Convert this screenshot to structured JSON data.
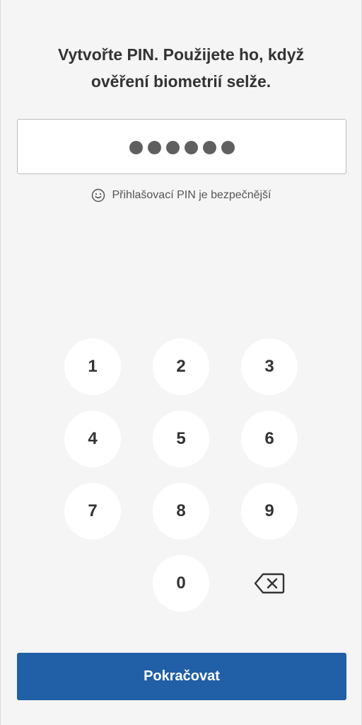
{
  "title": {
    "line1": "Vytvořte PIN. Použijete ho, když",
    "line2": "ověření biometrií selže."
  },
  "pin": {
    "entered_digits": 6,
    "masked": "●●●●●●"
  },
  "hint": {
    "icon": "smiley-icon",
    "text": "Přihlašovací PIN je bezpečnější"
  },
  "keypad": {
    "keys": [
      "1",
      "2",
      "3",
      "4",
      "5",
      "6",
      "7",
      "8",
      "9",
      "0"
    ],
    "backspace_icon": "backspace-icon"
  },
  "continue_label": "Pokračovat",
  "colors": {
    "primary": "#215fa7",
    "background": "#f5f5f5",
    "dot": "#5f5f5f"
  }
}
